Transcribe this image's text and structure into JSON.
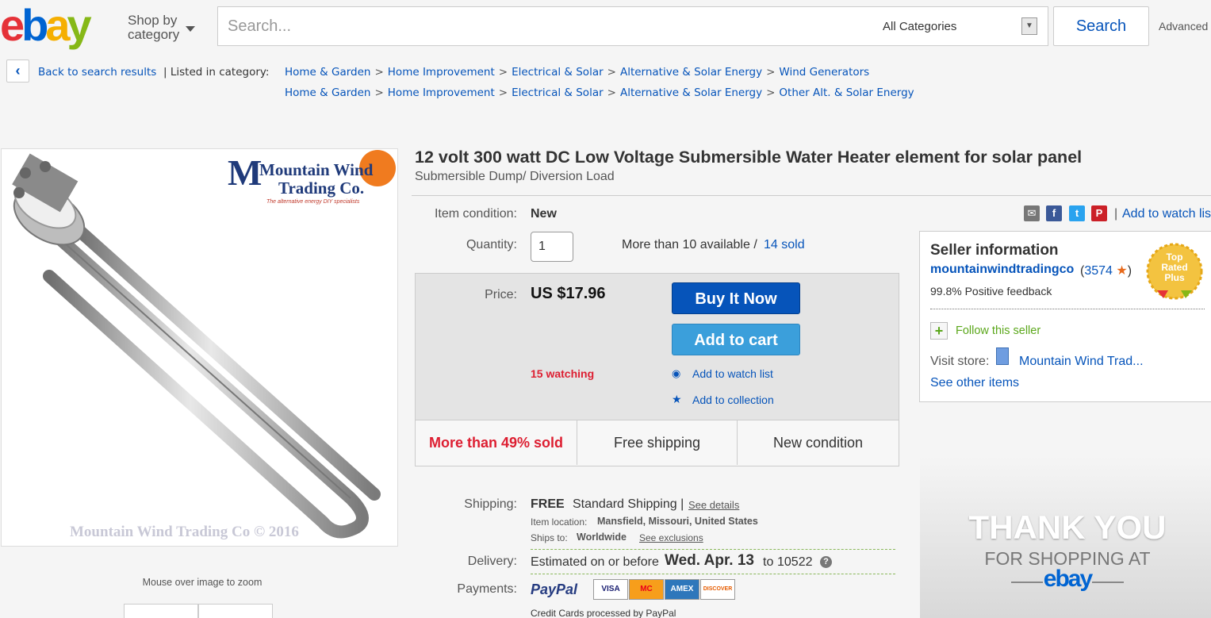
{
  "header": {
    "shop_by_line1": "Shop by",
    "shop_by_line2": "category",
    "search_placeholder": "Search...",
    "category_select": "All Categories",
    "search_button": "Search",
    "advanced": "Advanced"
  },
  "breadcrumb": {
    "back": "Back to search results",
    "listed_in": "| Listed in category:",
    "row1": [
      "Home & Garden",
      "Home Improvement",
      "Electrical & Solar",
      "Alternative & Solar Energy",
      "Wind Generators"
    ],
    "row2": [
      "Home & Garden",
      "Home Improvement",
      "Electrical & Solar",
      "Alternative & Solar Energy",
      "Other Alt. & Solar Energy"
    ],
    "separator": ">"
  },
  "image": {
    "brand_line1": "Mountain Wind",
    "brand_line2": "Trading Co.",
    "brand_tag": "The alternative energy DIY specialists",
    "watermark": "Mountain Wind Trading Co ©  2016",
    "zoom_hint": "Mouse over image to zoom"
  },
  "item": {
    "title": "12 volt 300 watt DC Low Voltage Submersible Water Heater element for solar panel",
    "subtitle": "Submersible Dump/ Diversion Load",
    "condition_label": "Item condition:",
    "condition_value": "New",
    "quantity_label": "Quantity:",
    "quantity_value": "1",
    "available": "More than 10 available /",
    "sold": "14 sold",
    "price_label": "Price:",
    "price_value": "US $17.96",
    "buy_now": "Buy It Now",
    "add_to_cart": "Add to cart",
    "watching": "15 watching",
    "add_watch": "Add to watch list",
    "add_collection": "Add to collection",
    "strip": [
      "More than 49% sold",
      "Free shipping",
      "New condition"
    ],
    "share_watch": "Add to watch lis"
  },
  "shipping": {
    "label": "Shipping:",
    "free": "FREE",
    "method": "Standard Shipping |",
    "see_details": "See details",
    "location_label": "Item location:",
    "location_value": "Mansfield, Missouri, United States",
    "ships_label": "Ships to:",
    "ships_value": "Worldwide",
    "see_exclusions": "See exclusions",
    "delivery_label": "Delivery:",
    "delivery_pre": "Estimated on or before",
    "delivery_date": "Wed. Apr. 13",
    "delivery_to": "to",
    "delivery_zip": "10522",
    "payments_label": "Payments:",
    "paypal": "PayPal",
    "cards": [
      "VISA",
      "MC",
      "AMEX",
      "DISCOVER"
    ],
    "cards_note": "Credit Cards processed by PayPal"
  },
  "seller": {
    "heading": "Seller information",
    "name": "mountainwindtradingco",
    "score": "3574",
    "feedback": "99.8% Positive feedback",
    "badge_line1": "Top",
    "badge_line2": "Rated",
    "badge_line3": "Plus",
    "follow": "Follow this seller",
    "visit_label": "Visit store:",
    "store_name": "Mountain Wind Trad...",
    "other_items": "See other items"
  },
  "promo": {
    "line1": "THANK YOU",
    "line2": "FOR SHOPPING AT",
    "line3": "ebay"
  },
  "colors": {
    "ebay_e": "#e53238",
    "ebay_b": "#0064d2",
    "ebay_a": "#f5af02",
    "ebay_y": "#86b817",
    "link": "#0654ba",
    "alert_red": "#dd1e31",
    "buy_blue": "#0654ba"
  }
}
